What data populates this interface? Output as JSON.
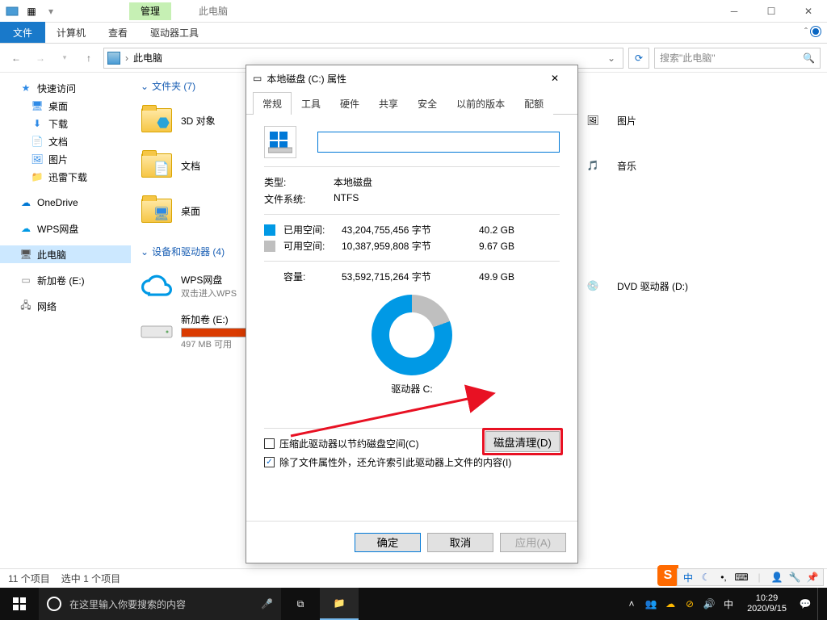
{
  "titlebar": {
    "manage_tab": "管理",
    "title": "此电脑"
  },
  "ribbon": {
    "file": "文件",
    "computer": "计算机",
    "view": "查看",
    "drive_tools": "驱动器工具"
  },
  "nav": {
    "location": "此电脑",
    "search_placeholder": "搜索\"此电脑\""
  },
  "sidebar": {
    "quick": "快速访问",
    "desktop": "桌面",
    "downloads": "下载",
    "documents": "文档",
    "pictures": "图片",
    "xunlei": "迅雷下载",
    "onedrive": "OneDrive",
    "wps": "WPS网盘",
    "thispc": "此电脑",
    "newvol": "新加卷 (E:)",
    "network": "网络"
  },
  "content": {
    "folders_hdr": "文件夹 (7)",
    "devices_hdr": "设备和驱动器 (4)",
    "items": {
      "obj3d": "3D 对象",
      "docs": "文档",
      "desktop": "桌面",
      "pictures": "图片",
      "music": "音乐",
      "dvd": "DVD 驱动器 (D:)",
      "wps": "WPS网盘",
      "wps_sub": "双击进入WPS",
      "newvol": "新加卷 (E:)",
      "newvol_sub": "497 MB 可用"
    }
  },
  "status": {
    "count": "11 个项目",
    "selected": "选中 1 个项目"
  },
  "dialog": {
    "title": "本地磁盘 (C:) 属性",
    "tabs": {
      "general": "常规",
      "tools": "工具",
      "hardware": "硬件",
      "sharing": "共享",
      "security": "安全",
      "prev": "以前的版本",
      "quota": "配额"
    },
    "type_k": "类型:",
    "type_v": "本地磁盘",
    "fs_k": "文件系统:",
    "fs_v": "NTFS",
    "used_k": "已用空间:",
    "used_bytes": "43,204,755,456 字节",
    "used_gb": "40.2 GB",
    "free_k": "可用空间:",
    "free_bytes": "10,387,959,808 字节",
    "free_gb": "9.67 GB",
    "cap_k": "容量:",
    "cap_bytes": "53,592,715,264 字节",
    "cap_gb": "49.9 GB",
    "drive_label": "驱动器 C:",
    "cleanup": "磁盘清理(D)",
    "compress": "压缩此驱动器以节约磁盘空间(C)",
    "index": "除了文件属性外，还允许索引此驱动器上文件的内容(I)",
    "ok": "确定",
    "cancel": "取消",
    "apply": "应用(A)"
  },
  "taskbar": {
    "search_placeholder": "在这里输入你要搜索的内容",
    "ime": "中",
    "time": "10:29",
    "date": "2020/9/15"
  },
  "langbar": {
    "ime": "中"
  }
}
